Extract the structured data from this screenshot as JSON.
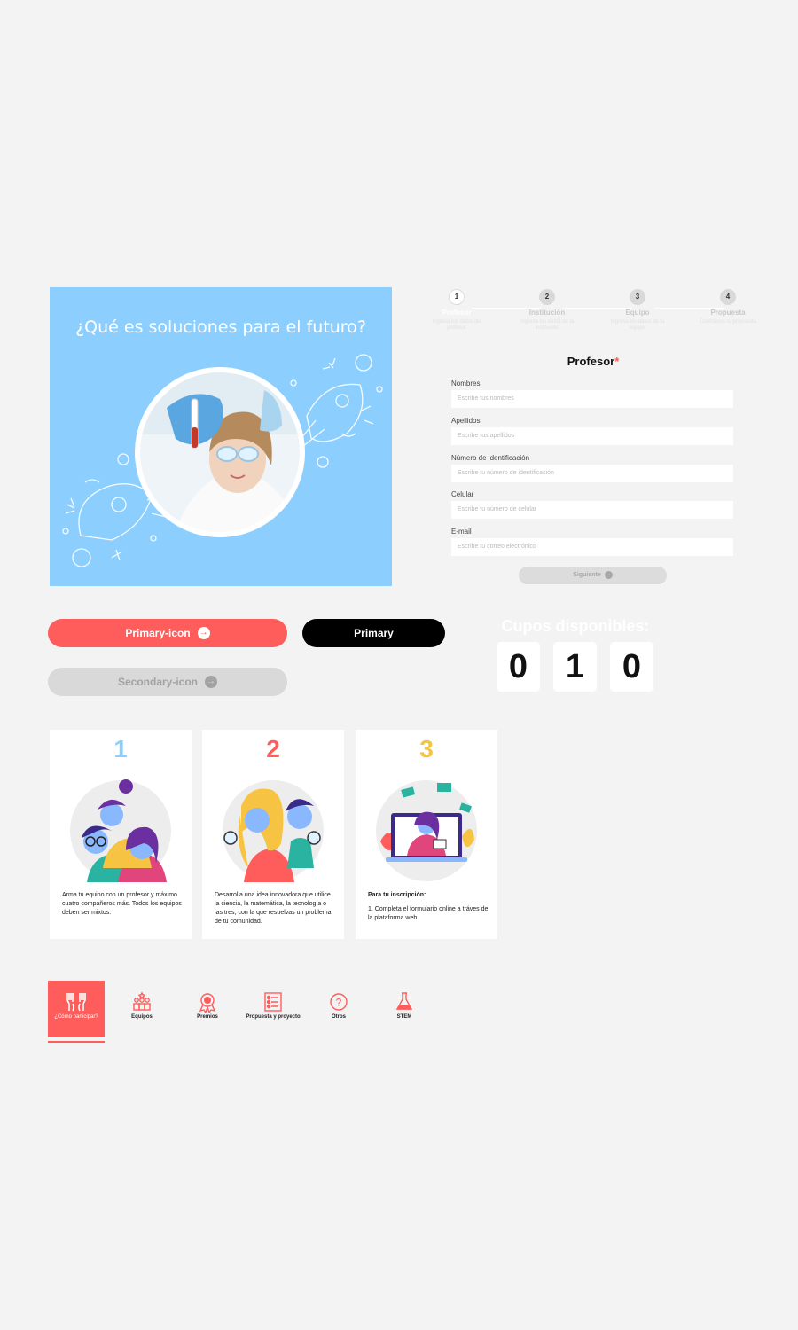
{
  "hero": {
    "title": "¿Qué es soluciones para el futuro?"
  },
  "stepper": {
    "steps": [
      {
        "num": "1",
        "label": "Profesor",
        "sub": "Ingresa los datos del profesor",
        "active": true
      },
      {
        "num": "2",
        "label": "Institución",
        "sub": "Ingresa los datos de la institución"
      },
      {
        "num": "3",
        "label": "Equipo",
        "sub": "Ingresa los datos de tu equipo"
      },
      {
        "num": "4",
        "label": "Propuesta",
        "sub": "Cuéntanos tu propuesta"
      }
    ]
  },
  "form": {
    "title": "Profesor",
    "required_mark": "*",
    "fields": [
      {
        "label": "Nombres",
        "placeholder": "Escribe tus nombres"
      },
      {
        "label": "Apellidos",
        "placeholder": "Escribe tus apellidos"
      },
      {
        "label": "Número de identificación",
        "placeholder": "Escribe tu número de identificación"
      },
      {
        "label": "Celular",
        "placeholder": "Escribe tu número de celular"
      },
      {
        "label": "E-mail",
        "placeholder": "Escribe tu correo electrónico"
      }
    ],
    "next_label": "Siguiente"
  },
  "buttons": {
    "primary_icon": "Primary-icon",
    "primary": "Primary",
    "secondary_icon": "Secondary-icon"
  },
  "counter": {
    "title": "Cupos disponibles:",
    "digits": [
      "0",
      "1",
      "0"
    ]
  },
  "cards": [
    {
      "num": "1",
      "color": "#8ccfff",
      "heading": "",
      "text": "Arma tu equipo con un profesor y máximo cuatro compañeros más. Todos los equipos deben ser mixtos."
    },
    {
      "num": "2",
      "color": "#ff5c5c",
      "heading": "",
      "text": "Desarrolla una idea innovadora que utilice la ciencia, la matemática, la tecnología o las tres, con la que resuelvas un problema de tu comunidad."
    },
    {
      "num": "3",
      "color": "#f5c542",
      "heading": "Para tu inscripción:",
      "text": "1. Completa el formulario online a tráves de la plataforma web."
    }
  ],
  "tabs": [
    {
      "label": "¿Cómo participar?",
      "icon": "raised-hands-icon",
      "active": true
    },
    {
      "label": "Equipos",
      "icon": "team-icon"
    },
    {
      "label": "Premios",
      "icon": "medal-icon"
    },
    {
      "label": "Propuesta y proyecto",
      "icon": "checklist-icon"
    },
    {
      "label": "Otros",
      "icon": "question-icon"
    },
    {
      "label": "STEM",
      "icon": "flask-icon"
    }
  ],
  "colors": {
    "accent": "#ff5c5c",
    "hero_bg": "#8ccfff",
    "yellow": "#f5c542"
  }
}
